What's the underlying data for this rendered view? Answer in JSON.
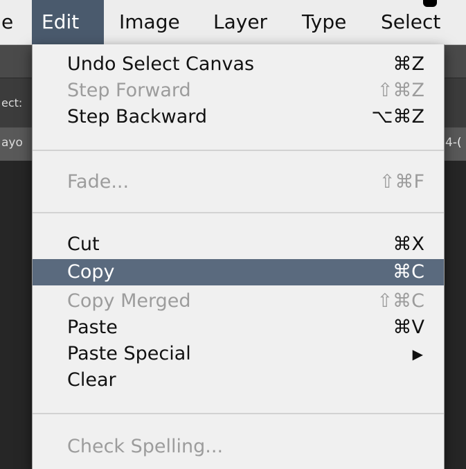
{
  "menubar": {
    "items": [
      {
        "label": "e"
      },
      {
        "label": "Edit"
      },
      {
        "label": "Image"
      },
      {
        "label": "Layer"
      },
      {
        "label": "Type"
      },
      {
        "label": "Select"
      }
    ]
  },
  "background": {
    "left_fragment_1": "ect:",
    "left_fragment_2": "ayo",
    "right_fragment": "4-("
  },
  "edit_menu": {
    "items": [
      {
        "label": "Undo Select Canvas",
        "shortcut": "⌘Z",
        "state": "enabled"
      },
      {
        "label": "Step Forward",
        "shortcut": "⇧⌘Z",
        "state": "disabled"
      },
      {
        "label": "Step Backward",
        "shortcut": "⌥⌘Z",
        "state": "enabled"
      },
      {
        "label": "Fade...",
        "shortcut": "⇧⌘F",
        "state": "disabled"
      },
      {
        "label": "Cut",
        "shortcut": "⌘X",
        "state": "enabled"
      },
      {
        "label": "Copy",
        "shortcut": "⌘C",
        "state": "highlighted"
      },
      {
        "label": "Copy Merged",
        "shortcut": "⇧⌘C",
        "state": "disabled"
      },
      {
        "label": "Paste",
        "shortcut": "⌘V",
        "state": "enabled"
      },
      {
        "label": "Paste Special",
        "submenu_icon": "triangle-right-icon",
        "state": "enabled"
      },
      {
        "label": "Clear",
        "state": "enabled"
      },
      {
        "label": "Check Spelling...",
        "state": "disabled"
      }
    ]
  },
  "colors": {
    "menu_highlight": "#5a6a7e",
    "menubar_active": "#4a5a6d",
    "disabled_text": "#9c9c9c"
  }
}
